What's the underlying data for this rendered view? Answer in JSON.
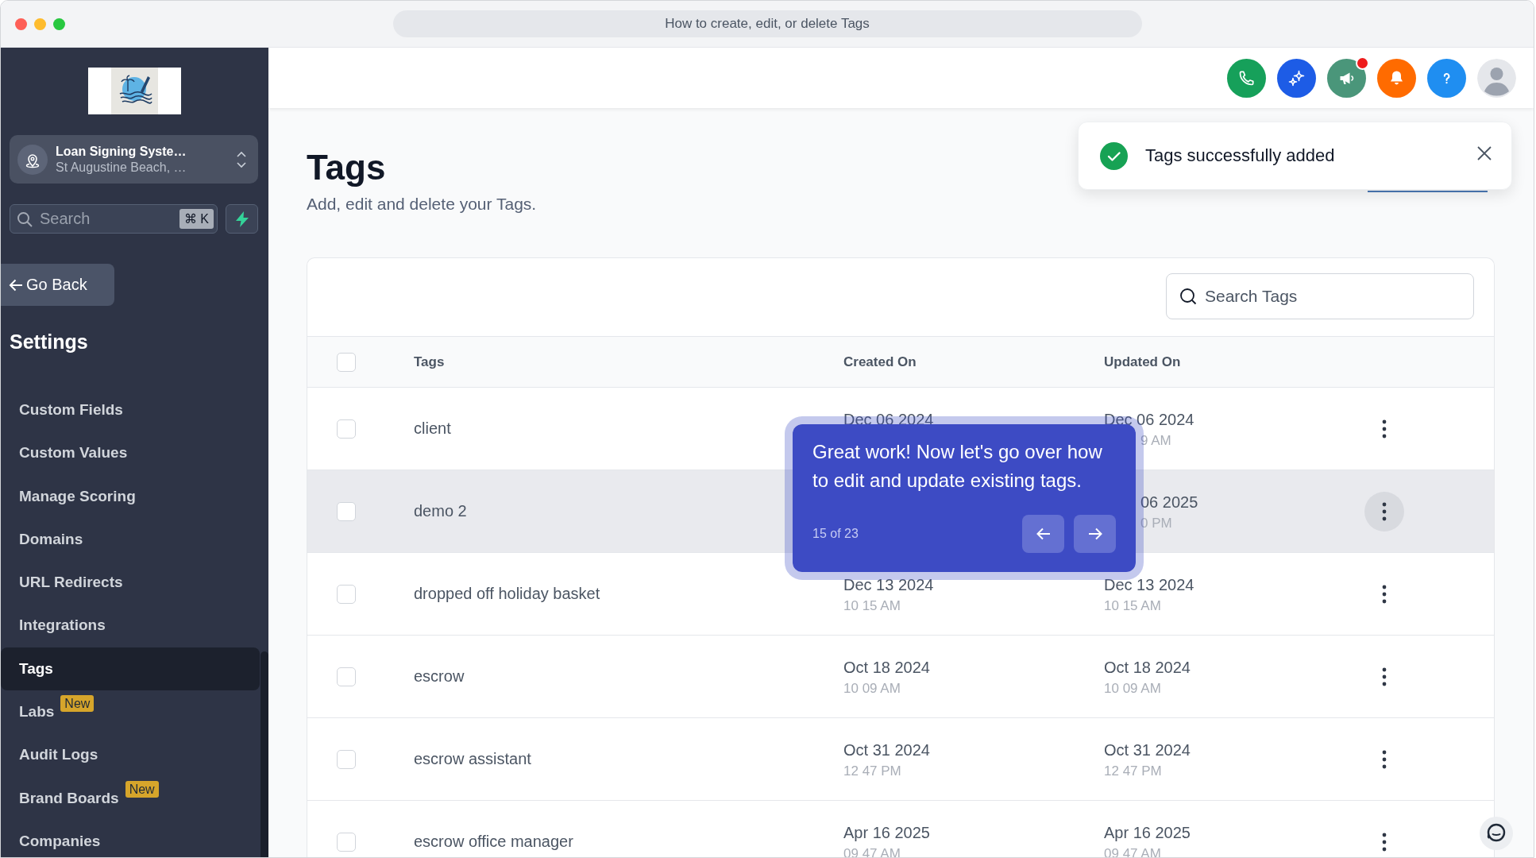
{
  "browser": {
    "title": "How to create, edit, or delete Tags"
  },
  "sidebar": {
    "location": {
      "name": "Loan Signing Syste…",
      "address": "St Augustine Beach, …"
    },
    "search": {
      "placeholder": "Search",
      "shortcut": "⌘ K"
    },
    "back_button": "Go Back",
    "section_title": "Settings",
    "items": [
      {
        "label": "Custom Fields",
        "selected": false
      },
      {
        "label": "Custom Values",
        "selected": false
      },
      {
        "label": "Manage Scoring",
        "selected": false
      },
      {
        "label": "Domains",
        "selected": false
      },
      {
        "label": "URL Redirects",
        "selected": false
      },
      {
        "label": "Integrations",
        "selected": false
      },
      {
        "label": "Tags",
        "selected": true
      },
      {
        "label": "Labs",
        "selected": false,
        "badge": "New"
      },
      {
        "label": "Audit Logs",
        "selected": false
      },
      {
        "label": "Brand Boards",
        "selected": false,
        "badge": "New"
      },
      {
        "label": "Companies",
        "selected": false
      }
    ]
  },
  "header": {
    "actions": [
      {
        "kind": "phone",
        "color": "#16a05a",
        "unread": false
      },
      {
        "kind": "sparkle",
        "color": "#1d5ce6",
        "unread": false
      },
      {
        "kind": "megaphone",
        "color": "#4a967a",
        "unread": true
      },
      {
        "kind": "bell",
        "color": "#ff6b00",
        "unread": false
      },
      {
        "kind": "help",
        "color": "#1f8ef1",
        "unread": false
      },
      {
        "kind": "avatar",
        "unread": false
      }
    ]
  },
  "page": {
    "title": "Tags",
    "subtitle": "Add, edit and delete your Tags."
  },
  "toast": {
    "message": "Tags successfully added"
  },
  "table": {
    "search": {
      "placeholder": "Search Tags"
    },
    "select_all": {
      "checked": false
    },
    "columns": [
      "Tags",
      "Created On",
      "Updated On"
    ],
    "rows": [
      {
        "tag": "client",
        "checked": false,
        "hovered": false,
        "created": [
          {
            "kind": "date",
            "text": "Dec 06 2024"
          }
        ],
        "updated": [
          {
            "kind": "date",
            "text": "Dec 06 2024"
          },
          {
            "kind": "timetail",
            "text": "9 AM"
          }
        ]
      },
      {
        "tag": "demo 2",
        "checked": false,
        "hovered": true,
        "updated": [
          {
            "kind": "datetail",
            "text": "06 2025"
          },
          {
            "kind": "timetail",
            "text": "0 PM"
          }
        ]
      },
      {
        "tag": "dropped off holiday basket",
        "checked": false,
        "hovered": false,
        "created": [
          {
            "kind": "date",
            "text": "Dec 13 2024"
          },
          {
            "kind": "time",
            "text": "10 15 AM"
          }
        ],
        "updated": [
          {
            "kind": "date",
            "text": "Dec 13 2024"
          },
          {
            "kind": "time",
            "text": "10 15 AM"
          }
        ]
      },
      {
        "tag": "escrow",
        "checked": false,
        "hovered": false,
        "created": [
          {
            "kind": "date",
            "text": "Oct 18 2024"
          },
          {
            "kind": "time",
            "text": "10 09 AM"
          }
        ],
        "updated": [
          {
            "kind": "date",
            "text": "Oct 18 2024"
          },
          {
            "kind": "time",
            "text": "10 09 AM"
          }
        ]
      },
      {
        "tag": "escrow assistant",
        "checked": false,
        "hovered": false,
        "created": [
          {
            "kind": "date",
            "text": "Oct 31 2024"
          },
          {
            "kind": "time",
            "text": "12 47 PM"
          }
        ],
        "updated": [
          {
            "kind": "date",
            "text": "Oct 31 2024"
          },
          {
            "kind": "time",
            "text": "12 47 PM"
          }
        ]
      },
      {
        "tag": "escrow office manager",
        "checked": false,
        "hovered": false,
        "created": [
          {
            "kind": "date",
            "text": "Apr 16 2025"
          },
          {
            "kind": "time",
            "text": "09 47 AM"
          }
        ],
        "updated": [
          {
            "kind": "date",
            "text": "Apr 16 2025"
          },
          {
            "kind": "time",
            "text": "09 47 AM"
          }
        ]
      }
    ]
  },
  "tour": {
    "message": "Great work! Now let's go over how to edit and update existing tags.",
    "step": "15 of 23"
  }
}
